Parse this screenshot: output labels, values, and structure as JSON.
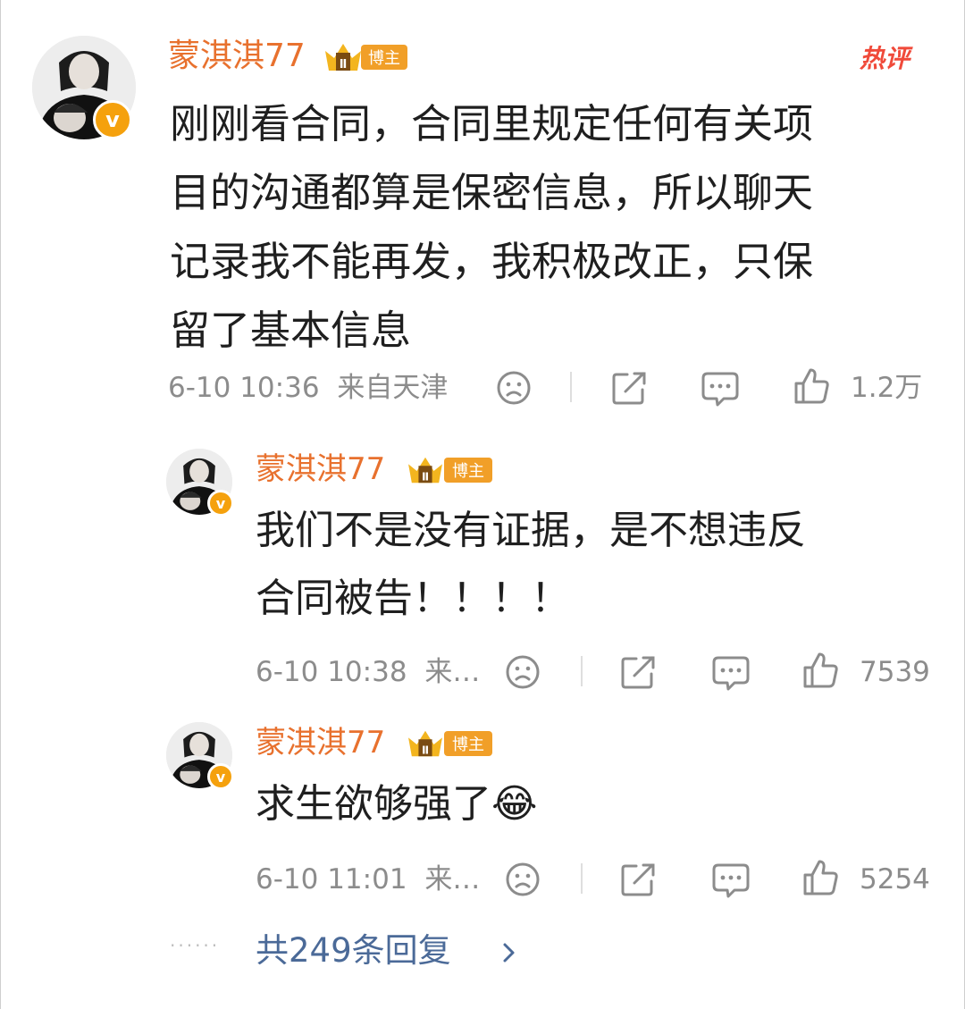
{
  "hot_label": "热评",
  "main_comment": {
    "username": "蒙淇淇77",
    "badge": "博主",
    "text_lines": [
      "刚刚看合同，合同里规定任何有关项",
      "目的沟通都算是保密信息，所以聊天",
      "记录我不能再发，我积极改正，只保",
      "留了基本信息"
    ],
    "time": "6-10 10:36",
    "location": "来自天津",
    "likes": "1.2万"
  },
  "replies": [
    {
      "username": "蒙淇淇77",
      "badge": "博主",
      "text_lines": [
        "我们不是没有证据，是不想违反",
        "合同被告！！！！"
      ],
      "time": "6-10 10:38",
      "location": "来…",
      "likes": "7539"
    },
    {
      "username": "蒙淇淇77",
      "badge": "博主",
      "text_lines": [
        "求生欲够强了"
      ],
      "emoji": "😂",
      "time": "6-10 11:01",
      "location": "来…",
      "likes": "5254"
    }
  ],
  "more_replies": "共249条回复",
  "colors": {
    "username": "#e8712e",
    "badge": "#f19f28",
    "link": "#4b6a98",
    "meta": "#8c8c8c",
    "hot": "#f04a3a"
  }
}
